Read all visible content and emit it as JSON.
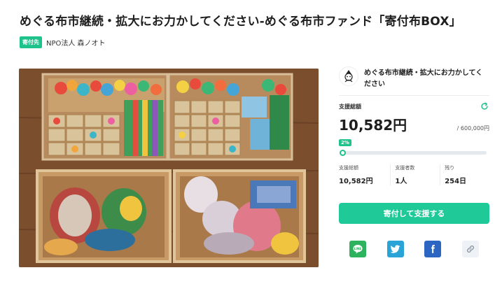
{
  "project": {
    "title": "めぐる布市継続・拡大にお力かしてください-めぐる布市ファンド「寄付布BOX」",
    "org_badge": "寄付先",
    "org_name": "NPO法人 森ノオト"
  },
  "photo": {
    "description": "boxes-of-fabric-and-stuffed-toys"
  },
  "fund": {
    "name": "めぐる布市継続・拡大にお力かしてください",
    "total_label": "支援総額",
    "total_amount": "10,582円",
    "goal": "/ 600,000円",
    "progress_percent_label": "2%",
    "progress_fraction": 0.02,
    "stats": [
      {
        "label": "支援総額",
        "value": "10,582円"
      },
      {
        "label": "支援者数",
        "value": "1人"
      },
      {
        "label": "残り",
        "value": "254日"
      }
    ],
    "cta_label": "寄付して支援する"
  },
  "share": {
    "icons": [
      "line-icon",
      "twitter-icon",
      "facebook-icon",
      "link-icon"
    ]
  },
  "colors": {
    "accent": "#1ec28b",
    "cta": "#20c998",
    "line": "#2db35e",
    "twitter": "#2aa4d7",
    "facebook": "#2d65c2"
  }
}
